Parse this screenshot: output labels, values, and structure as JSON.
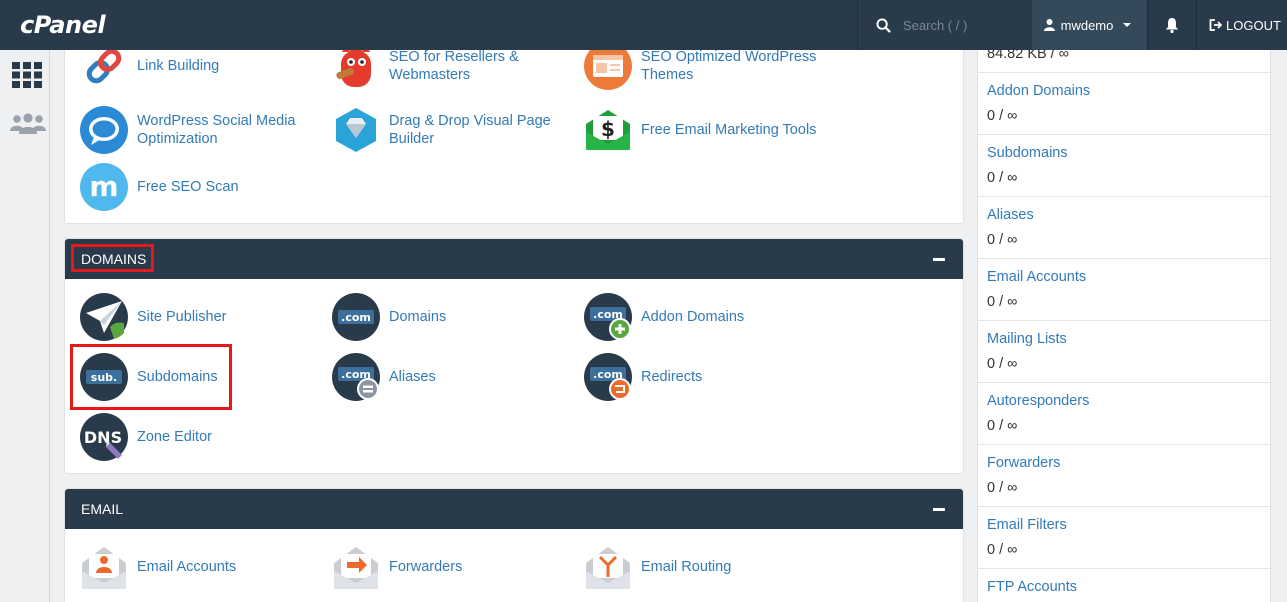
{
  "app": {
    "logo": "cPanel"
  },
  "topbar": {
    "search_placeholder": "Search ( / )",
    "username": "mwdemo",
    "logout_label": "LOGOUT"
  },
  "top_section": {
    "items": [
      {
        "label_line1": "Link Building",
        "label_line2": ""
      },
      {
        "label_line1": "SEO for Resellers &",
        "label_line2": "Webmasters"
      },
      {
        "label_line1": "SEO Optimized WordPress",
        "label_line2": "Themes"
      },
      {
        "label_line1": "WordPress Social Media",
        "label_line2": "Optimization"
      },
      {
        "label_line1": "Drag & Drop Visual Page",
        "label_line2": "Builder"
      },
      {
        "label_line1": "Free Email Marketing Tools",
        "label_line2": ""
      },
      {
        "label_line1": "Free SEO Scan",
        "label_line2": ""
      }
    ]
  },
  "domains": {
    "title": "DOMAINS",
    "items": [
      {
        "label": "Site Publisher"
      },
      {
        "label": "Domains"
      },
      {
        "label": "Addon Domains"
      },
      {
        "label": "Subdomains"
      },
      {
        "label": "Aliases"
      },
      {
        "label": "Redirects"
      },
      {
        "label": "Zone Editor"
      }
    ]
  },
  "email": {
    "title": "EMAIL",
    "items": [
      {
        "label": "Email Accounts"
      },
      {
        "label": "Forwarders"
      },
      {
        "label": "Email Routing"
      }
    ]
  },
  "icon_texts": {
    "com": ".com",
    "sub": "sub.",
    "dns": "DNS",
    "dollar": "$",
    "m": "m"
  },
  "stats": {
    "partial_value": "84.82 KB / ∞",
    "items": [
      {
        "name": "Addon Domains",
        "value": "0 / ∞"
      },
      {
        "name": "Subdomains",
        "value": "0 / ∞"
      },
      {
        "name": "Aliases",
        "value": "0 / ∞"
      },
      {
        "name": "Email Accounts",
        "value": "0 / ∞"
      },
      {
        "name": "Mailing Lists",
        "value": "0 / ∞"
      },
      {
        "name": "Autoresponders",
        "value": "0 / ∞"
      },
      {
        "name": "Forwarders",
        "value": "0 / ∞"
      },
      {
        "name": "Email Filters",
        "value": "0 / ∞"
      },
      {
        "name": "FTP Accounts",
        "value": ""
      }
    ]
  },
  "colors": {
    "topbar": "#293a4a",
    "link": "#337ab7",
    "highlight": "#e41a1a"
  }
}
